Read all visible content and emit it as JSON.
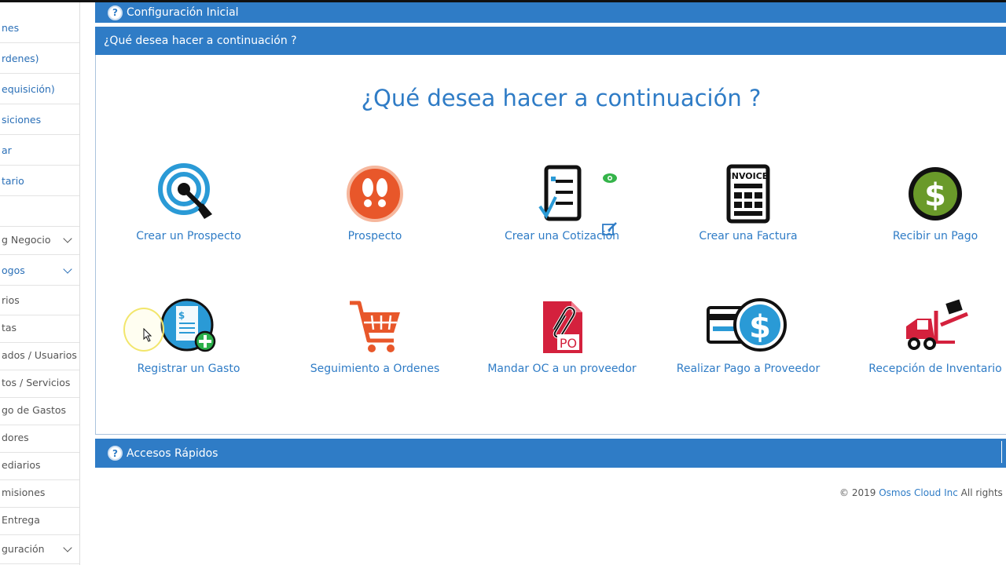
{
  "sidebar": {
    "items": [
      {
        "label": "nes"
      },
      {
        "label": "rdenes)"
      },
      {
        "label": "equisición)"
      },
      {
        "label": "siciones"
      },
      {
        "label": "ar"
      },
      {
        "label": "tario"
      },
      {
        "label": ""
      },
      {
        "label": "g Negocio"
      },
      {
        "label": "ogos"
      },
      {
        "label": "rios"
      },
      {
        "label": "tas"
      },
      {
        "label": "ados / Usuarios"
      },
      {
        "label": "tos / Servicios"
      },
      {
        "label": "go de Gastos"
      },
      {
        "label": "dores"
      },
      {
        "label": "ediarios"
      },
      {
        "label": "misiones"
      },
      {
        "label": "Entrega"
      },
      {
        "label": "guración"
      }
    ]
  },
  "panels": {
    "config": "Configuración Inicial",
    "next": "¿Qué desea hacer a continuación ?",
    "quick": "Accesos Rápidos",
    "help_icon_glyph": "?"
  },
  "main": {
    "title": "¿Qué desea hacer a continuación ?",
    "tiles": [
      {
        "label": "Crear un Prospecto"
      },
      {
        "label": "Prospecto"
      },
      {
        "label": "Crear una Cotización"
      },
      {
        "label": "Crear una Factura"
      },
      {
        "label": "Recibir un Pago"
      },
      {
        "label": "Registrar un Gasto"
      },
      {
        "label": "Seguimiento a Ordenes"
      },
      {
        "label": "Mandar OC a un proveedor"
      },
      {
        "label": "Realizar Pago a Proveedor"
      },
      {
        "label": "Recepción de Inventario"
      }
    ],
    "icon_text": {
      "invoice": "INVOICE",
      "po": "PO",
      "dollar": "$"
    }
  },
  "footer": {
    "prefix": "© 2019",
    "company": "Osmos Cloud Inc",
    "suffix": "All rights rese"
  },
  "colors": {
    "accent": "#2f7cc6",
    "orange": "#e8572a",
    "green": "#6a9a2a",
    "red": "#d4213d"
  }
}
